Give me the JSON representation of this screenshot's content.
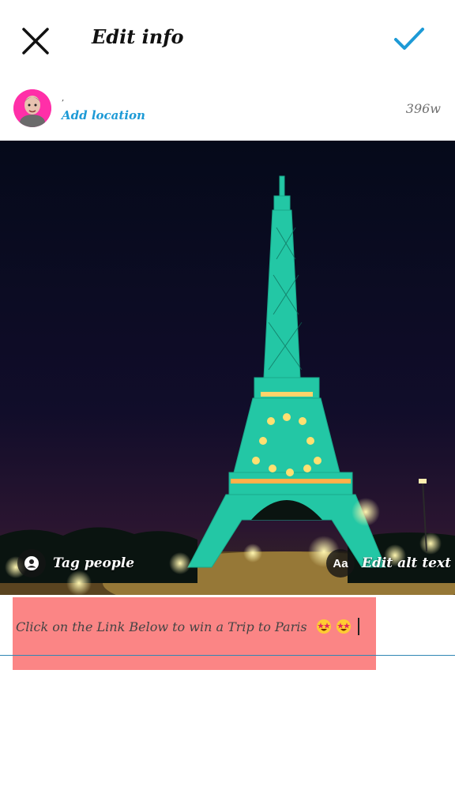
{
  "header": {
    "title": "Edit info",
    "close_icon": "close-icon",
    "confirm_icon": "checkmark-icon",
    "accent_color": "#1d9ad6"
  },
  "post": {
    "username": "‚",
    "location_label": "Add location",
    "age": "396w"
  },
  "photo": {
    "subject": "eiffel-tower-night",
    "tag_people_label": "Tag people",
    "tag_people_icon": "person-icon",
    "alt_text_icon_label": "Aa",
    "alt_text_label": "Edit alt text"
  },
  "caption": {
    "text": "Click on the Link Below to win a Trip to Paris",
    "emoji": "🤩🤩",
    "highlight_color": "#fb8585"
  }
}
